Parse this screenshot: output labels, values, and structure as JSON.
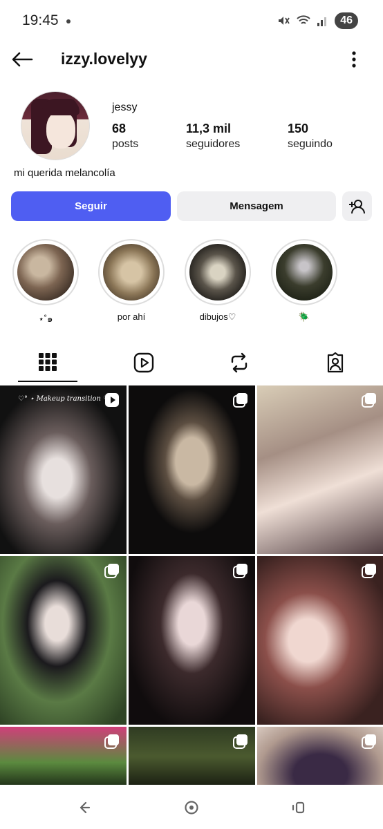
{
  "status_bar": {
    "time": "19:45",
    "battery": "46"
  },
  "header": {
    "username": "izzy.lovelyy"
  },
  "profile": {
    "display_name": "jessy",
    "posts_count": "68",
    "posts_label": "posts",
    "followers_count": "11,3 mil",
    "followers_label": "seguidores",
    "following_count": "150",
    "following_label": "seguindo",
    "bio": "mi querida melancolía"
  },
  "actions": {
    "follow_label": "Seguir",
    "message_label": "Mensagem"
  },
  "highlights": [
    {
      "label": "⋆˚๑"
    },
    {
      "label": "por ahí"
    },
    {
      "label": "dibujos♡"
    },
    {
      "label": "🪲"
    }
  ],
  "posts": {
    "first_caption": "♡° ⋆ Makeup transition ♡°"
  },
  "colors": {
    "accent": "#4f5ef2",
    "secondary_button": "#efeff1"
  }
}
